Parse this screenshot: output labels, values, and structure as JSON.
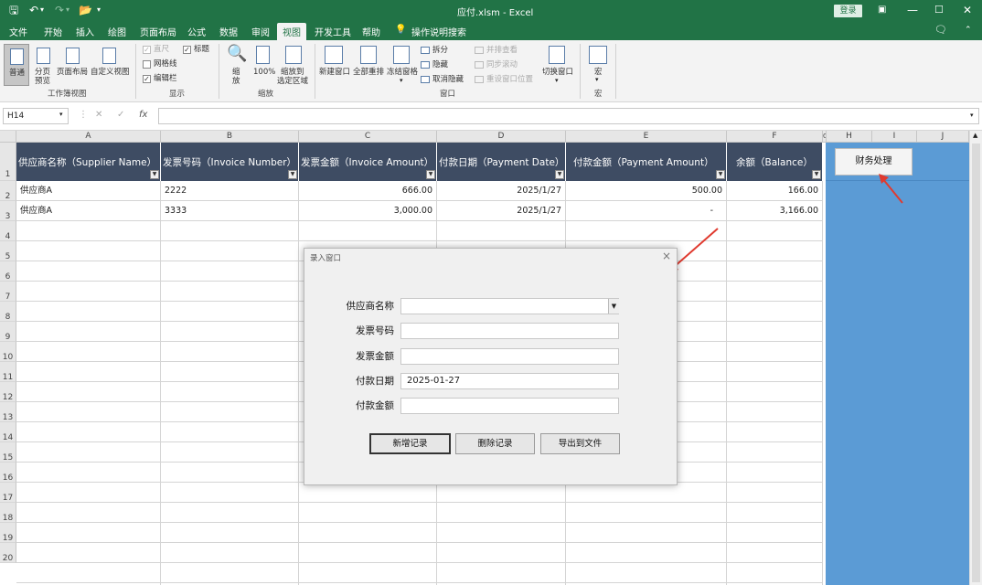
{
  "titlebar": {
    "title": "应付.xlsm  -  Excel",
    "login_label": "登录"
  },
  "menu": {
    "tabs": [
      "文件",
      "开始",
      "插入",
      "绘图",
      "页面布局",
      "公式",
      "数据",
      "审阅",
      "视图",
      "开发工具",
      "帮助",
      "操作说明搜索"
    ],
    "active_tab": "视图"
  },
  "ribbon": {
    "view_normal": "普通",
    "view_pagebreak_1": "分页",
    "view_pagebreak_2": "预览",
    "view_pagelayout": "页面布局",
    "view_custom": "自定义视图",
    "group_views": "工作簿视图",
    "show_ruler": "直尺",
    "show_gridlines": "网格线",
    "show_formulabar": "编辑栏",
    "show_headings": "标题",
    "group_show": "显示",
    "zoom_1": "缩",
    "zoom_2": "放",
    "zoom_100": "100%",
    "zoom_selection_1": "缩放到",
    "zoom_selection_2": "选定区域",
    "group_zoom": "缩放",
    "new_window": "新建窗口",
    "arrange_all": "全部重排",
    "freeze_panes": "冻结窗格",
    "split": "拆分",
    "hide": "隐藏",
    "unhide": "取消隐藏",
    "side_by_side": "并排查看",
    "sync_scroll": "同步滚动",
    "reset_position": "重设窗口位置",
    "switch_windows": "切换窗口",
    "group_window": "窗口",
    "macros": "宏",
    "group_macros": "宏"
  },
  "formula_bar": {
    "name_box": "H14",
    "fx": "fx",
    "value": ""
  },
  "grid": {
    "columns": [
      "A",
      "B",
      "C",
      "D",
      "E",
      "F",
      "G",
      "H",
      "I",
      "J"
    ],
    "rows": [
      "1",
      "2",
      "3",
      "4",
      "5",
      "6",
      "7",
      "8",
      "9",
      "10",
      "11",
      "12",
      "13",
      "14",
      "15",
      "16",
      "17",
      "18",
      "19",
      "20"
    ],
    "headers": [
      "供应商名称（Supplier Name）",
      "发票号码（Invoice Number）",
      "发票金额（Invoice Amount）",
      "付款日期（Payment Date）",
      "付款金额（Payment Amount）",
      "余额（Balance）"
    ],
    "data": [
      [
        "供应商A",
        "2222",
        "666.00",
        "2025/1/27",
        "500.00",
        "166.00"
      ],
      [
        "供应商A",
        "3333",
        "3,000.00",
        "2025/1/27",
        "-",
        "3,166.00"
      ]
    ]
  },
  "finance_button": "财务处理",
  "dialog": {
    "title": "录入窗口",
    "close": "×",
    "fields": [
      {
        "label": "供应商名称",
        "value": ""
      },
      {
        "label": "发票号码",
        "value": ""
      },
      {
        "label": "发票金额",
        "value": ""
      },
      {
        "label": "付款日期",
        "value": "2025-01-27"
      },
      {
        "label": "付款金额",
        "value": ""
      }
    ],
    "buttons": {
      "add": "新增记录",
      "delete": "删除记录",
      "export": "导出到文件"
    }
  },
  "colors": {
    "excel_green": "#217346",
    "header_fill": "#3e4c63",
    "side_panel": "#5b9bd5",
    "arrow": "#e03a2f"
  }
}
